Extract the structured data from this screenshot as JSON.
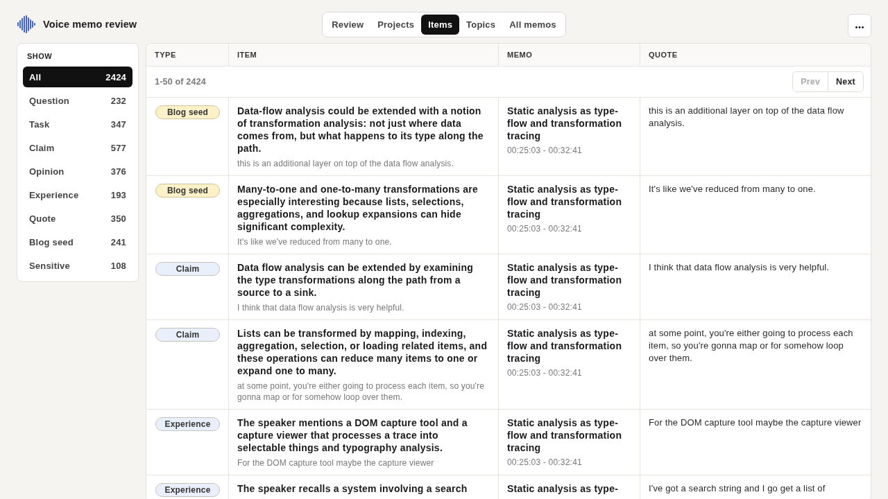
{
  "app": {
    "title": "Voice memo review"
  },
  "tabs": [
    {
      "label": "Review",
      "selected": false
    },
    {
      "label": "Projects",
      "selected": false
    },
    {
      "label": "Items",
      "selected": true
    },
    {
      "label": "Topics",
      "selected": false
    },
    {
      "label": "All memos",
      "selected": false
    }
  ],
  "sidebar": {
    "heading": "SHOW",
    "items": [
      {
        "label": "All",
        "count": "2424",
        "selected": true
      },
      {
        "label": "Question",
        "count": "232",
        "selected": false
      },
      {
        "label": "Task",
        "count": "347",
        "selected": false
      },
      {
        "label": "Claim",
        "count": "577",
        "selected": false
      },
      {
        "label": "Opinion",
        "count": "376",
        "selected": false
      },
      {
        "label": "Experience",
        "count": "193",
        "selected": false
      },
      {
        "label": "Quote",
        "count": "350",
        "selected": false
      },
      {
        "label": "Blog seed",
        "count": "241",
        "selected": false
      },
      {
        "label": "Sensitive",
        "count": "108",
        "selected": false
      }
    ]
  },
  "table": {
    "columns": [
      "TYPE",
      "ITEM",
      "MEMO",
      "QUOTE"
    ],
    "pagination": {
      "range": "1-50 of 2424",
      "prev": {
        "label": "Prev",
        "disabled": true
      },
      "next": {
        "label": "Next",
        "disabled": false
      }
    },
    "rows": [
      {
        "type": {
          "label": "Blog seed",
          "color": "#fcf1c8"
        },
        "item": {
          "title": "Data-flow analysis could be extended with a notion of transformation analysis: not just where data comes from, but what happens to its type along the path.",
          "snippet": "this is an additional layer on top of the data flow analysis."
        },
        "memo": {
          "title": "Static analysis as type-flow and transformation tracing",
          "time": "00:25:03 - 00:32:41"
        },
        "quote": "this is an additional layer on top of the data flow analysis."
      },
      {
        "type": {
          "label": "Blog seed",
          "color": "#fcf1c8"
        },
        "item": {
          "title": "Many-to-one and one-to-many transformations are especially interesting because lists, selections, aggregations, and lookup expansions can hide significant complexity.",
          "snippet": "It's like we've reduced from many to one."
        },
        "memo": {
          "title": "Static analysis as type-flow and transformation tracing",
          "time": "00:25:03 - 00:32:41"
        },
        "quote": "It's like we've reduced from many to one."
      },
      {
        "type": {
          "label": "Claim",
          "color": "#e9f0fb"
        },
        "item": {
          "title": "Data flow analysis can be extended by examining the type transformations along the path from a source to a sink.",
          "snippet": "I think that data flow analysis is very helpful."
        },
        "memo": {
          "title": "Static analysis as type-flow and transformation tracing",
          "time": "00:25:03 - 00:32:41"
        },
        "quote": "I think that data flow analysis is very helpful."
      },
      {
        "type": {
          "label": "Claim",
          "color": "#e9f0fb"
        },
        "item": {
          "title": "Lists can be transformed by mapping, indexing, aggregation, selection, or loading related items, and these operations can reduce many items to one or expand one to many.",
          "snippet": "at some point, you're either going to process each item, so you're gonna map or for somehow loop over them."
        },
        "memo": {
          "title": "Static analysis as type-flow and transformation tracing",
          "time": "00:25:03 - 00:32:41"
        },
        "quote": "at some point, you're either going to process each item, so you're gonna map or for somehow loop over them."
      },
      {
        "type": {
          "label": "Experience",
          "color": "#e9f0fb"
        },
        "item": {
          "title": "The speaker mentions a DOM capture tool and a capture viewer that processes a trace into selectable things and typography analysis.",
          "snippet": "For the DOM capture tool maybe the capture viewer"
        },
        "memo": {
          "title": "Static analysis as type-flow and transformation tracing",
          "time": "00:25:03 - 00:32:41"
        },
        "quote": "For the DOM capture tool maybe the capture viewer"
      },
      {
        "type": {
          "label": "Experience",
          "color": "#e9f0fb"
        },
        "item": {
          "title": "The speaker recalls a system involving a search"
        },
        "memo": {
          "title": "Static analysis as type-"
        },
        "quote": "I've got a search string and I go get a list of"
      }
    ]
  }
}
